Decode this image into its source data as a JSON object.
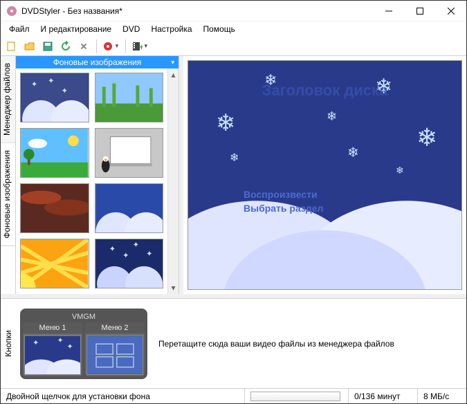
{
  "titlebar": {
    "app": "DVDStyler",
    "doc": "Без названия*",
    "full": "DVDStyler - Без названия*"
  },
  "menu": {
    "file": "Файл",
    "edit": "И редактирование",
    "dvd": "DVD",
    "settings": "Настройка",
    "help": "Помощь"
  },
  "side_tabs": {
    "file_manager": "Менеджер файлов",
    "backgrounds": "Фоновые изображения",
    "buttons": "Кнопки"
  },
  "panel_header": "Фоновые изображения",
  "preview": {
    "title": "Заголовок диска",
    "play": "Воспроизвести",
    "select": "Выбрать раздел"
  },
  "menus_group": {
    "label": "VMGM",
    "menu1": "Меню 1",
    "menu2": "Меню 2"
  },
  "drop_hint": "Перетащите сюда ваши видео файлы из менеджера файлов",
  "status": {
    "hint": "Двойной щелчок для установки фона",
    "time": "0/136 минут",
    "rate": "8 МБ/с"
  }
}
